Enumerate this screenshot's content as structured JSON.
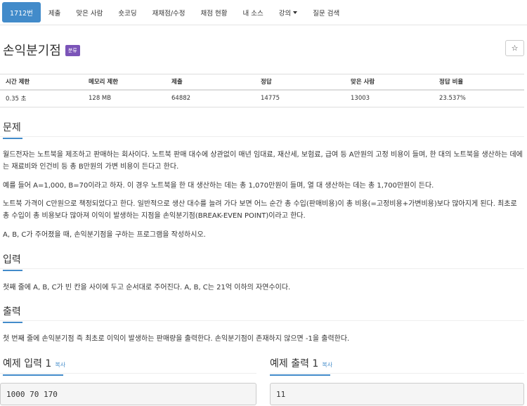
{
  "nav": {
    "items": [
      {
        "label": "1712번",
        "active": true
      },
      {
        "label": "제출"
      },
      {
        "label": "맞은 사람"
      },
      {
        "label": "숏코딩"
      },
      {
        "label": "재채점/수정"
      },
      {
        "label": "채점 현황"
      },
      {
        "label": "내 소스"
      },
      {
        "label": "강의",
        "dropdown": true
      },
      {
        "label": "질문 검색"
      }
    ]
  },
  "problem": {
    "title": "손익분기점",
    "badge": "분류",
    "star": "☆"
  },
  "stats": {
    "headers": [
      "시간 제한",
      "메모리 제한",
      "제출",
      "정답",
      "맞은 사람",
      "정답 비율"
    ],
    "values": [
      "0.35 초",
      "128 MB",
      "64882",
      "14775",
      "13003",
      "23.537%"
    ]
  },
  "sections": {
    "problem_heading": "문제",
    "problem_paragraphs": [
      "월드전자는 노트북을 제조하고 판매하는 회사이다. 노트북 판매 대수에 상관없이 매년 임대료, 재산세, 보험료, 급여 등 A만원의 고정 비용이 들며, 한 대의 노트북을 생산하는 데에는 재료비와 인건비 등 총 B만원의 가변 비용이 든다고 한다.",
      "예를 들어 A=1,000, B=70이라고 하자. 이 경우 노트북을 한 대 생산하는 데는 총 1,070만원이 들며, 열 대 생산하는 데는 총 1,700만원이 든다.",
      "노트북 가격이 C만원으로 책정되었다고 한다. 일반적으로 생산 대수를 늘려 가다 보면 어느 순간 총 수입(판매비용)이 총 비용(=고정비용+가변비용)보다 많아지게 된다. 최초로 총 수입이 총 비용보다 많아져 이익이 발생하는 지점을 손익분기점(BREAK-EVEN POINT)이라고 한다.",
      "A, B, C가 주어졌을 때, 손익분기점을 구하는 프로그램을 작성하시오."
    ],
    "input_heading": "입력",
    "input_text": "첫째 줄에 A, B, C가 빈 칸을 사이에 두고 순서대로 주어진다. A, B, C는 21억 이하의 자연수이다.",
    "output_heading": "출력",
    "output_text": "첫 번째 줄에 손익분기점 즉 최초로 이익이 발생하는 판매량을 출력한다. 손익분기점이 존재하지 않으면 -1을 출력한다."
  },
  "samples": {
    "input_heading": "예제 입력 1",
    "output_heading": "예제 출력 1",
    "copy_label": "복사",
    "input_value": "1000 70 170",
    "output_value": "11"
  }
}
